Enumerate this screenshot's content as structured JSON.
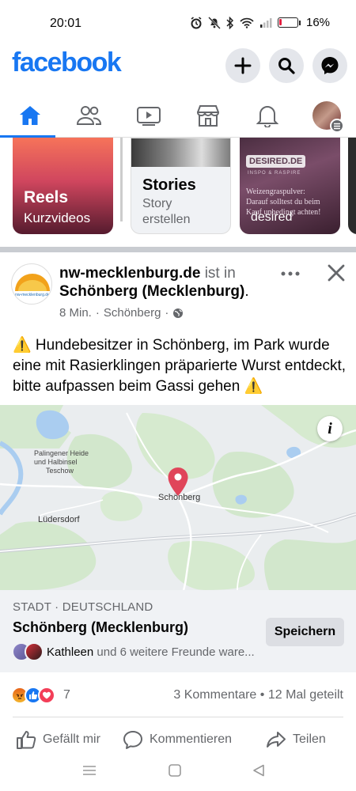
{
  "status_bar": {
    "time": "20:01",
    "battery": "16%"
  },
  "header": {
    "logo": "facebook"
  },
  "nav": {
    "tabs": [
      {
        "name": "home",
        "icon": "home-icon",
        "active": true
      },
      {
        "name": "friends",
        "icon": "friends-icon"
      },
      {
        "name": "watch",
        "icon": "video-icon"
      },
      {
        "name": "marketplace",
        "icon": "shop-icon"
      },
      {
        "name": "notifications",
        "icon": "bell-icon"
      },
      {
        "name": "menu",
        "icon": "profile-avatar"
      }
    ]
  },
  "stories": {
    "reels": {
      "title": "Reels",
      "subtitle": "Kurzvideos"
    },
    "create": {
      "title": "Stories",
      "subtitle_line1": "Story",
      "subtitle_line2": "erstellen"
    },
    "desired": {
      "badge": "DESIRED.DE",
      "tagline": "INSPO & RASPIRE",
      "text_line1": "Weizengraspulver:",
      "text_line2": "Darauf solltest du beim",
      "text_line3": "Kauf unbedingt achten!",
      "name": "desired"
    }
  },
  "post": {
    "page_avatar_text": "nw-mecklenburg.de",
    "page_name": "nw-mecklenburg.de",
    "connector": " ist in",
    "location": "Schönberg (Mecklenburg)",
    "location_suffix": ".",
    "time": "8 Min.",
    "meta_place": "Schönberg",
    "text": "⚠️ Hundebesitzer in Schönberg, im Park wurde eine mit Rasierklingen präparierte Wurst entdeckt, bitte aufpassen beim Gassi gehen ⚠️"
  },
  "map": {
    "info_label": "i",
    "labels": {
      "heath": "Palingener Heide",
      "heath2": "und Halbinsel",
      "heath3": "Teschow",
      "town": "Schönberg",
      "village": "Lüdersdorf"
    }
  },
  "place": {
    "type": "STADT · DEUTSCHLAND",
    "name": "Schönberg (Mecklenburg)",
    "friend_name": "Kathleen",
    "friends_rest": " und 6 weitere Freunde ware...",
    "save_label": "Speichern"
  },
  "reactions": {
    "count": "7",
    "comments": "3 Kommentare",
    "separator": " • ",
    "shares": "12 Mal geteilt"
  },
  "actions": {
    "like": "Gefällt mir",
    "comment": "Kommentieren",
    "share": "Teilen"
  },
  "colors": {
    "brand": "#1877f2",
    "pin": "#e0455a",
    "text_muted": "#65676b"
  }
}
